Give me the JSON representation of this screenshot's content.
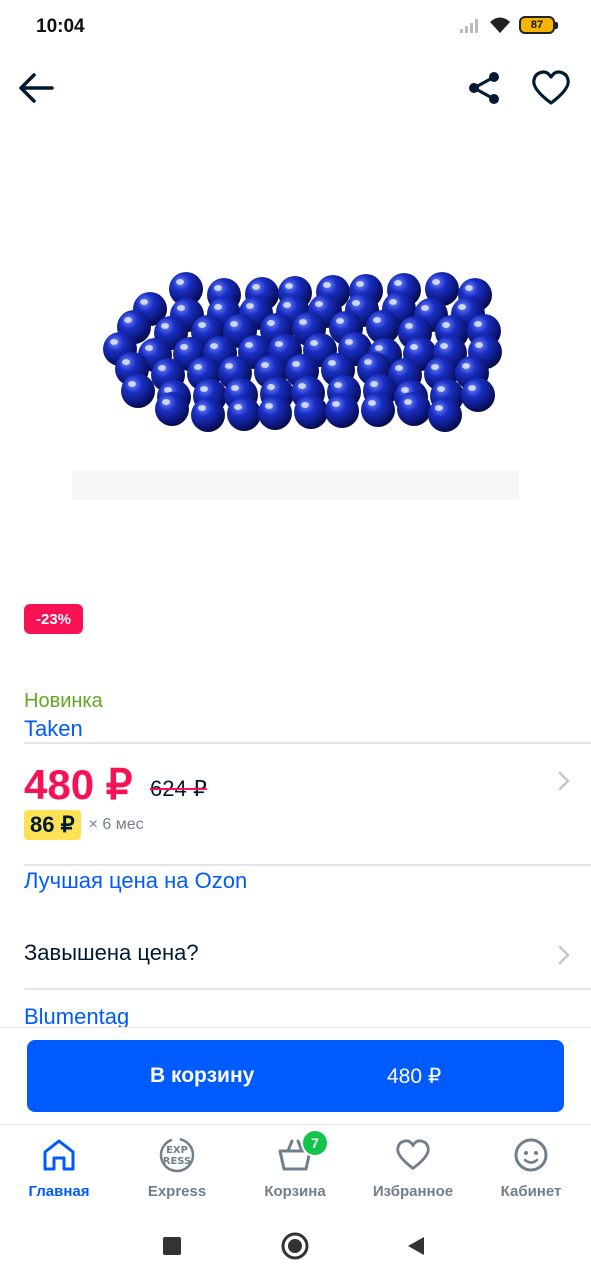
{
  "status_bar": {
    "time": "10:04",
    "battery": "87"
  },
  "toolbar": {
    "back_icon": "arrow-left-icon",
    "share_icon": "share-icon",
    "favorite_icon": "heart-icon"
  },
  "product": {
    "image": "blue glass marbles",
    "discount": "-23%",
    "new_label": "Новинка",
    "brand": "Taken",
    "price": "480 ₽",
    "old_price": "624 ₽",
    "installment_amount": "86 ₽",
    "installment_term": "× 6 мес",
    "best_price_link": "Лучшая цена на Ozon",
    "overpriced_label": "Завышена цена?",
    "seller": "Blumentag"
  },
  "cart_button": {
    "label": "В корзину",
    "price": "480 ₽"
  },
  "bottom_nav": {
    "items": [
      {
        "label": "Главная",
        "icon": "home-icon",
        "active": true
      },
      {
        "label": "Express",
        "icon": "express-icon"
      },
      {
        "label": "Корзина",
        "icon": "cart-icon",
        "badge": "7"
      },
      {
        "label": "Избранное",
        "icon": "heart-icon"
      },
      {
        "label": "Кабинет",
        "icon": "profile-icon"
      }
    ]
  },
  "colors": {
    "accent": "#005bff",
    "price": "#f91155",
    "new": "#5faa22",
    "badge": "#10c44c",
    "installment": "#ffe156"
  }
}
